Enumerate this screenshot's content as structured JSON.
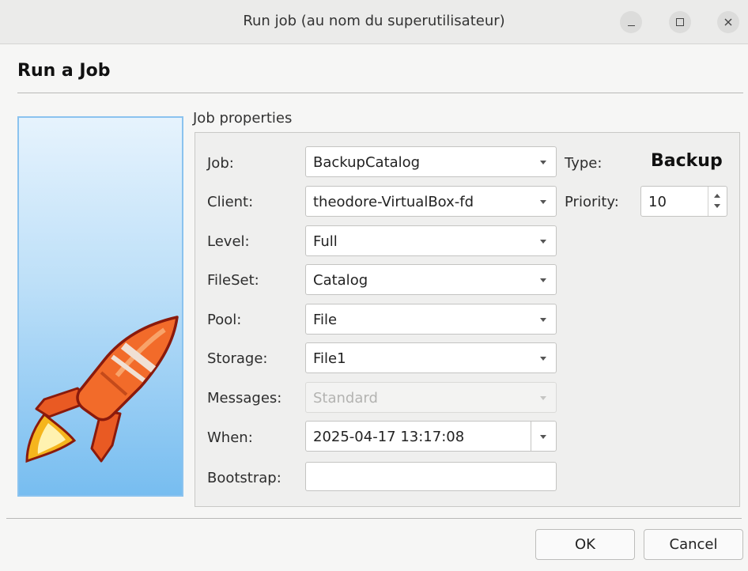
{
  "window": {
    "title": "Run job (au nom du superutilisateur)",
    "controls": [
      "minimize-icon",
      "maximize-icon",
      "close-icon"
    ]
  },
  "dialog": {
    "heading": "Run a Job",
    "group_title": "Job properties"
  },
  "form": {
    "job": {
      "label": "Job:",
      "value": "BackupCatalog"
    },
    "client": {
      "label": "Client:",
      "value": "theodore-VirtualBox-fd"
    },
    "level": {
      "label": "Level:",
      "value": "Full"
    },
    "fileset": {
      "label": "FileSet:",
      "value": "Catalog"
    },
    "pool": {
      "label": "Pool:",
      "value": "File"
    },
    "storage": {
      "label": "Storage:",
      "value": "File1"
    },
    "messages": {
      "label": "Messages:",
      "value": "Standard",
      "enabled": false
    },
    "when": {
      "label": "When:",
      "value": "2025-04-17 13:17:08"
    },
    "bootstrap": {
      "label": "Bootstrap:",
      "value": ""
    },
    "type": {
      "label": "Type:",
      "value": "Backup"
    },
    "priority": {
      "label": "Priority:",
      "value": "10"
    }
  },
  "buttons": {
    "ok": "OK",
    "cancel": "Cancel"
  },
  "side_image": {
    "icon": "rocket-icon"
  },
  "colors": {
    "image_gradient_top": "#e6f3fd",
    "image_gradient_bottom": "#77bdf0",
    "rocket_orange": "#f26b2a",
    "rocket_outline": "#8a1a0c"
  }
}
